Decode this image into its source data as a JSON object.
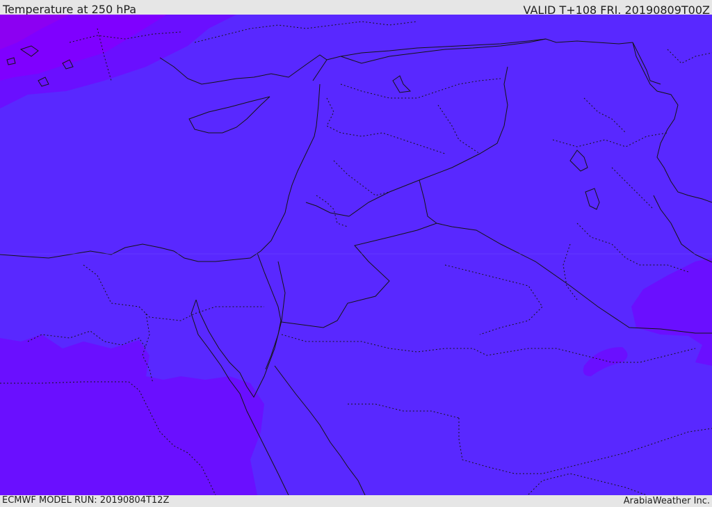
{
  "header": {
    "title": "Temperature at 250 hPa",
    "valid_time": "VALID T+108 FRI. 20190809T00Z"
  },
  "footer": {
    "model_run": "ECMWF MODEL RUN: 20190804T12Z",
    "credit": "ArabiaWeather Inc."
  },
  "map": {
    "colors": {
      "base": "#5928ff",
      "warm_band": "#6a0fff",
      "hot_band": "#7f00ff",
      "hottest_band": "#8c00f2",
      "coast_line": "#141414",
      "border_line": "#141414"
    }
  }
}
